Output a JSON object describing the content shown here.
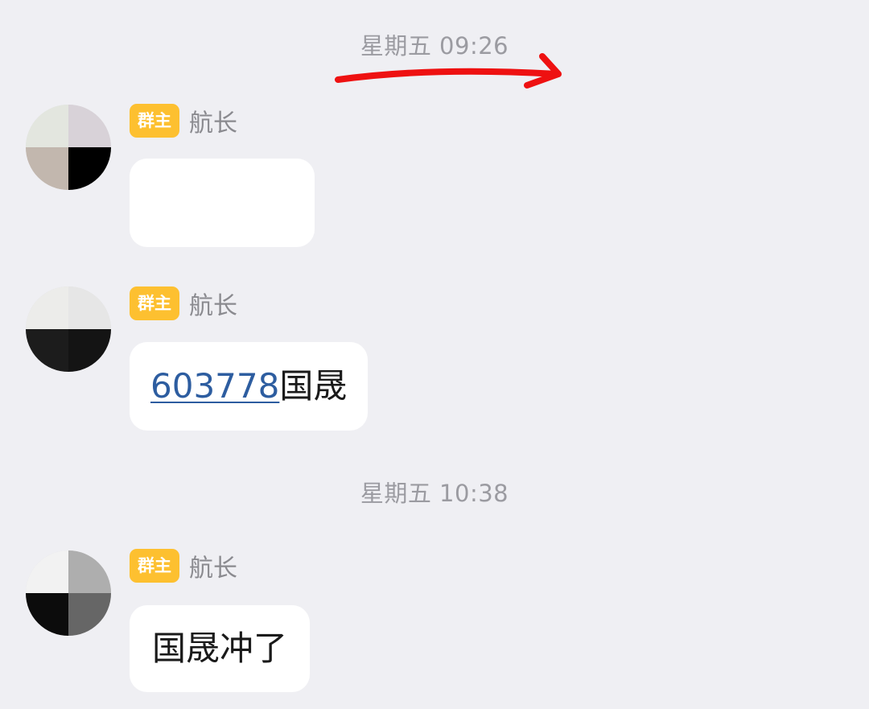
{
  "timestamps": [
    "星期五 09:26",
    "星期五 10:38"
  ],
  "messages": [
    {
      "role_badge": "群主",
      "sender": "航长",
      "content": "",
      "avatar_colors": [
        "#e3e6df",
        "#d8d2d8",
        "#c2b7ae",
        "#000000"
      ]
    },
    {
      "role_badge": "群主",
      "sender": "航长",
      "link": "603778",
      "text": "国晟",
      "avatar_colors": [
        "#ececea",
        "#e6e6e6",
        "#1c1c1c",
        "#141414"
      ]
    },
    {
      "role_badge": "群主",
      "sender": "航长",
      "text": "国晟冲了",
      "avatar_colors": [
        "#f2f2f2",
        "#aeaeae",
        "#0c0c0c",
        "#666666"
      ]
    }
  ],
  "colors": {
    "background": "#efeff3",
    "badge": "#fdc030",
    "link": "#2d5da0",
    "annotation": "#ee1111"
  }
}
